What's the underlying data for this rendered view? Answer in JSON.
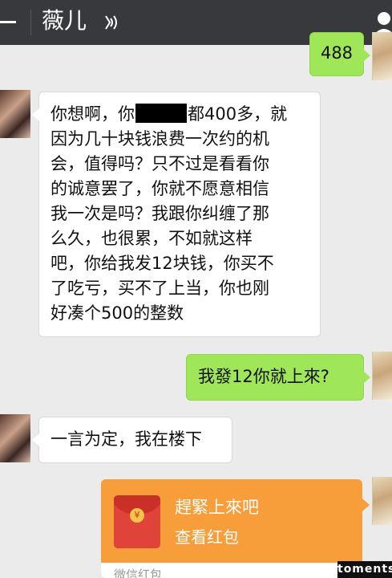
{
  "header": {
    "title": "薇儿",
    "back_icon": "back-arrow-icon",
    "voice_icon": "voice-mode-icon",
    "profile_icon": "person-icon",
    "background": "#38393d"
  },
  "messages": [
    {
      "side": "right",
      "type": "text",
      "text": "488",
      "avatar": "self-avatar"
    },
    {
      "side": "left",
      "type": "text",
      "avatar": "contact-avatar",
      "lines": [
        {
          "before": "你想啊，你",
          "redacted": true,
          "after": "都400多，就"
        },
        "因为几十块钱浪费一次约的机",
        "会，值得吗？只不过是看看你",
        "的诚意罢了，你就不愿意相信",
        "我一次是吗？我跟你纠缠了那",
        "么久，也很累，不如就这样",
        "吧，你给我发12块钱，你买不",
        "了吃亏，买不了上当，你也刚",
        "好凑个500的整数"
      ]
    },
    {
      "side": "right",
      "type": "text",
      "text": "我發12你就上來?",
      "avatar": "self-avatar"
    },
    {
      "side": "left",
      "type": "text",
      "text": "一言为定，我在楼下",
      "avatar": "contact-avatar"
    },
    {
      "side": "right",
      "type": "red_packet",
      "title": "趕緊上來吧",
      "subtitle": "查看红包",
      "footer": "微信红包",
      "coin_symbol": "¥",
      "avatar": "self-avatar"
    }
  ],
  "colors": {
    "chat_background": "#ebebeb",
    "sent_bubble": "#9fe658",
    "received_bubble": "#ffffff",
    "red_packet": "#f79d3a"
  },
  "watermark": "toments"
}
